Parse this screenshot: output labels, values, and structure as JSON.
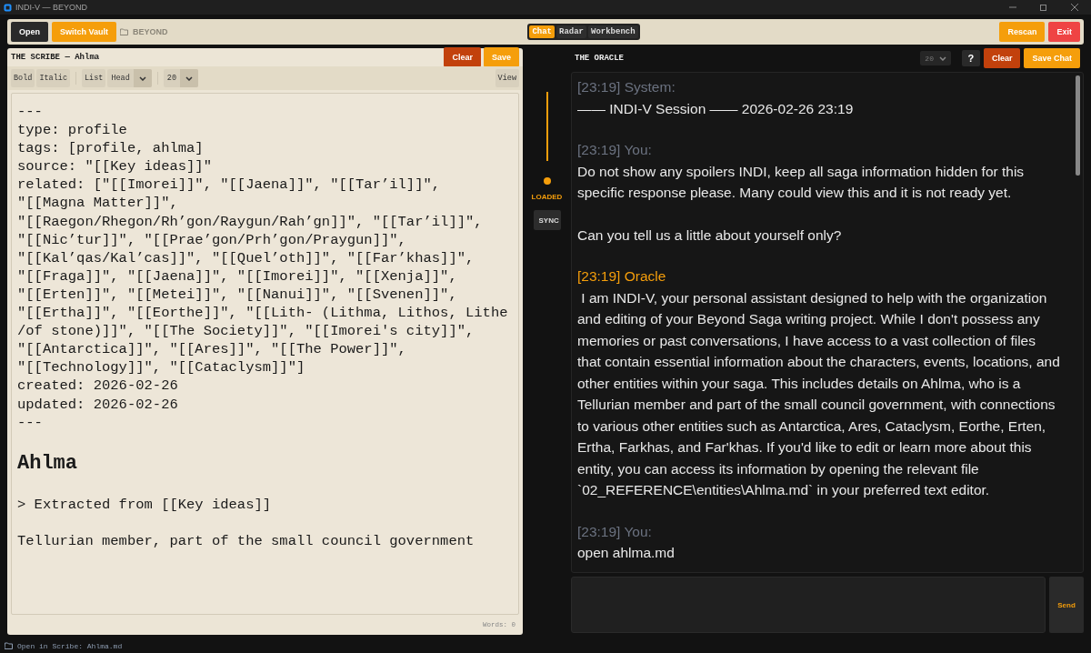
{
  "window": {
    "title": "INDI-V — BEYOND"
  },
  "toolbar": {
    "open": "Open",
    "switch_vault": "Switch Vault",
    "vault": "BEYOND",
    "tabs": [
      {
        "label": "Chat",
        "selected": true
      },
      {
        "label": "Radar",
        "selected": false
      },
      {
        "label": "Workbench",
        "selected": false
      }
    ],
    "rescan": "Rescan",
    "exit": "Exit"
  },
  "scribe": {
    "title": "THE SCRIBE — Ahlma",
    "clear": "Clear",
    "save": "Save",
    "format": {
      "bold": "Bold",
      "italic": "Italic",
      "list": "List",
      "head": "Head",
      "size": "20",
      "view": "View"
    },
    "lines": [
      {
        "kind": "code",
        "text": "---"
      },
      {
        "kind": "code",
        "text": "type: profile"
      },
      {
        "kind": "code",
        "text": "tags: [profile, ahlma]"
      },
      {
        "kind": "code",
        "text": "source: \"[[Key ideas]]\""
      },
      {
        "kind": "code",
        "text": "related: [\"[[Imorei]]\", \"[[Jaena]]\", \"[[Tar’il]]\","
      },
      {
        "kind": "code",
        "text": "\"[[Magna Matter]]\","
      },
      {
        "kind": "code",
        "text": "\"[[Raegon/Rhegon/Rh’gon/Raygun/Rah’gn]]\", \"[[Tar’il]]\","
      },
      {
        "kind": "code",
        "text": "\"[[Nic’tur]]\", \"[[Prae’gon/Prh’gon/Praygun]]\","
      },
      {
        "kind": "code",
        "text": "\"[[Kal’qas/Kal’cas]]\", \"[[Quel’oth]]\", \"[[Far’khas]]\","
      },
      {
        "kind": "code",
        "text": "\"[[Fraga]]\", \"[[Jaena]]\", \"[[Imorei]]\", \"[[Xenja]]\","
      },
      {
        "kind": "code",
        "text": "\"[[Erten]]\", \"[[Metei]]\", \"[[Nanui]]\", \"[[Svenen]]\","
      },
      {
        "kind": "code",
        "text": "\"[[Ertha]]\", \"[[Eorthe]]\", \"[[Lith- (Lithma, Lithos, Lithe"
      },
      {
        "kind": "code",
        "text": "/of stone)]]\", \"[[The Society]]\", \"[[Imorei's city]]\","
      },
      {
        "kind": "code",
        "text": "\"[[Antarctica]]\", \"[[Ares]]\", \"[[The Power]]\","
      },
      {
        "kind": "code",
        "text": "\"[[Technology]]\", \"[[Cataclysm]]\"]"
      },
      {
        "kind": "code",
        "text": "created: 2026-02-26"
      },
      {
        "kind": "code",
        "text": "updated: 2026-02-26"
      },
      {
        "kind": "code",
        "text": "---"
      },
      {
        "kind": "blank"
      },
      {
        "kind": "heading",
        "text": "Ahlma"
      },
      {
        "kind": "blank"
      },
      {
        "kind": "code",
        "text": "> Extracted from [[Key ideas]]"
      },
      {
        "kind": "blank"
      },
      {
        "kind": "code",
        "text": "Tellurian member, part of the small council government"
      }
    ],
    "words": "Words: 0"
  },
  "sync": {
    "status": "LOADED",
    "button": "SYNC"
  },
  "oracle": {
    "title": "THE ORACLE",
    "size": "20",
    "help": "?",
    "clear": "Clear",
    "save_chat": "Save Chat",
    "messages": [
      {
        "kind": "system",
        "header": "[23:19] System:",
        "paragraphs": [
          "—— INDI-V Session —— 2026-02-26 23:19"
        ]
      },
      {
        "kind": "user",
        "header": "[23:19] You:",
        "paragraphs": [
          "Do not show any spoilers INDI, keep all saga information hidden for this specific response please. Many could view this and it is not ready yet.",
          "Can you tell us a little about yourself only?"
        ]
      },
      {
        "kind": "oracle",
        "header": "[23:19] Oracle",
        "paragraphs": [
          " I am INDI-V, your personal assistant designed to help with the organization and editing of your Beyond Saga writing project. While I don't possess any memories or past conversations, I have access to a vast collection of files that contain essential information about the characters, events, locations, and other entities within your saga. This includes details on Ahlma, who is a Tellurian member and part of the small council government, with connections to various other entities such as Antarctica, Ares, Cataclysm, Eorthe, Erten, Ertha, Farkhas, and Far'khas. If you'd like to edit or learn more about this entity, you can access its information by opening the relevant file `02_REFERENCE\\entities\\Ahlma.md` in your preferred text editor."
        ]
      },
      {
        "kind": "user",
        "header": "[23:19] You:",
        "paragraphs": [
          "open ahlma.md"
        ]
      }
    ],
    "send": "Send"
  },
  "status_bar": {
    "text": "Open in Scribe: Ahlma.md"
  }
}
